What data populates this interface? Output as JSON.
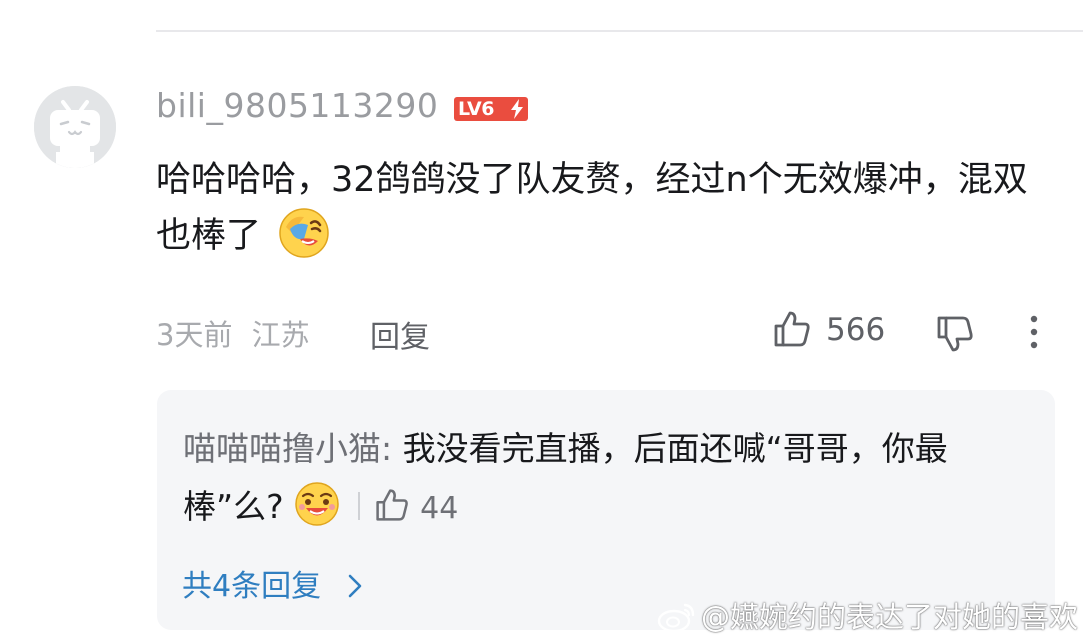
{
  "comment": {
    "username": "bili_9805113290",
    "level_badge": "LV6",
    "text": "哈哈哈哈，32鸽鸽没了队友赘，经过n个无效爆冲，混双也棒了",
    "emoji": "laughing-crying-emoji",
    "time_ago": "3天前",
    "location": "江苏",
    "reply_label": "回复",
    "like_count": "566"
  },
  "sub_reply": {
    "username": "喵喵喵撸小猫:",
    "text": " 我没看完直播，后面还喊“哥哥，你最棒”么?",
    "emoji": "grinning-drool-emoji",
    "like_count": "44"
  },
  "view_replies": {
    "label": "共4条回复"
  },
  "watermark": {
    "text": "@嬿婉约的表达了对她的喜欢"
  },
  "colors": {
    "level_badge": "#ea4d3f",
    "link": "#2f7ec0",
    "muted_text": "#9a9ca0",
    "reply_background": "#f5f6f8"
  }
}
